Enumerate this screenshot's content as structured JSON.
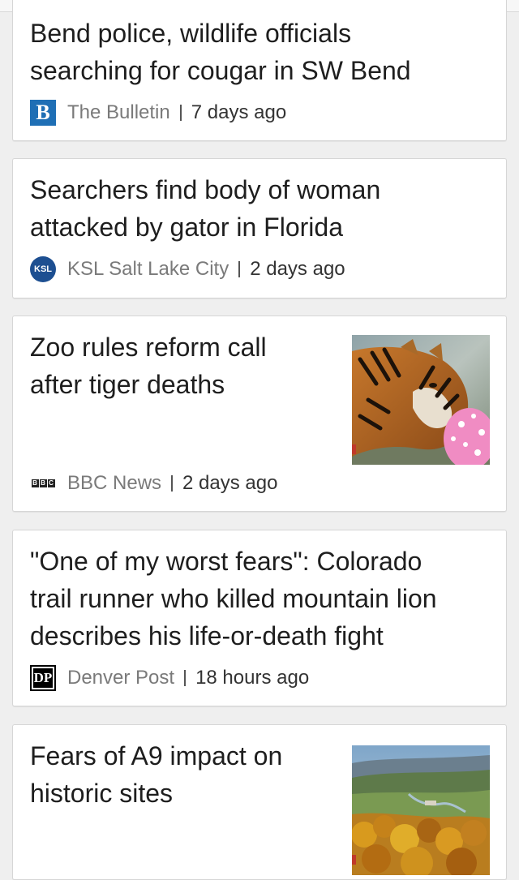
{
  "articles": [
    {
      "headline_lines": [
        "Bend police, wildlife officials",
        "searching for cougar in SW Bend"
      ],
      "source": "The Bulletin",
      "source_logo": "B",
      "time": "7 days ago",
      "has_thumbnail": false
    },
    {
      "headline_lines": [
        "Searchers find body of woman",
        "attacked by gator in Florida"
      ],
      "source": "KSL Salt Lake City",
      "source_logo": "KSL",
      "time": "2 days ago",
      "has_thumbnail": false
    },
    {
      "headline_lines": [
        "Zoo rules reform call",
        "after tiger deaths"
      ],
      "source": "BBC News",
      "source_logo": "BBC",
      "time": "2 days ago",
      "has_thumbnail": true,
      "thumbnail": "tiger-with-pink-ball"
    },
    {
      "headline_lines": [
        "\"One of my worst fears\": Colorado",
        "trail runner who killed mountain lion",
        "describes his life-or-death fight"
      ],
      "source": "Denver Post",
      "source_logo": "DP",
      "time": "18 hours ago",
      "has_thumbnail": false
    },
    {
      "headline_lines": [
        "Fears of A9 impact on",
        "historic sites"
      ],
      "source": "",
      "source_logo": "",
      "time": "",
      "has_thumbnail": true,
      "thumbnail": "autumn-valley-landscape"
    }
  ],
  "colors": {
    "background": "#efefef",
    "card": "#ffffff",
    "headline": "#1e1e1e",
    "source_text": "#7a7a7a",
    "bulletin_blue": "#1f6fb5",
    "ksl_blue": "#1d4f91"
  }
}
